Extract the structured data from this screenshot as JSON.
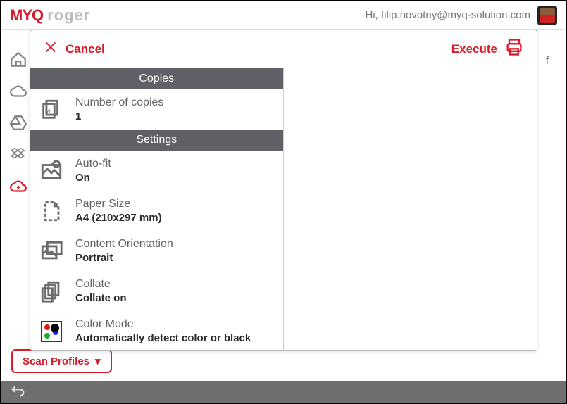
{
  "header": {
    "logo1": "MYQ",
    "logo2": "roger",
    "greeting": "Hi, filip.novotny@myq-solution.com"
  },
  "sidebar": {
    "items": [
      {
        "name": "home"
      },
      {
        "name": "cloud"
      },
      {
        "name": "drive"
      },
      {
        "name": "dropbox"
      },
      {
        "name": "scan-red"
      }
    ]
  },
  "bg": {
    "scan_profiles_label": "Scan Profiles",
    "placeholder_f": "f"
  },
  "modal": {
    "cancel_label": "Cancel",
    "execute_label": "Execute",
    "sections": {
      "copies_header": "Copies",
      "settings_header": "Settings"
    },
    "copies": {
      "label": "Number of copies",
      "value": "1"
    },
    "settings": [
      {
        "key": "autofit",
        "label": "Auto-fit",
        "value": "On"
      },
      {
        "key": "paper",
        "label": "Paper Size",
        "value": "A4 (210x297 mm)"
      },
      {
        "key": "orient",
        "label": "Content Orientation",
        "value": "Portrait"
      },
      {
        "key": "collate",
        "label": "Collate",
        "value": "Collate on"
      },
      {
        "key": "color",
        "label": "Color Mode",
        "value": "Automatically detect color or black"
      }
    ]
  }
}
